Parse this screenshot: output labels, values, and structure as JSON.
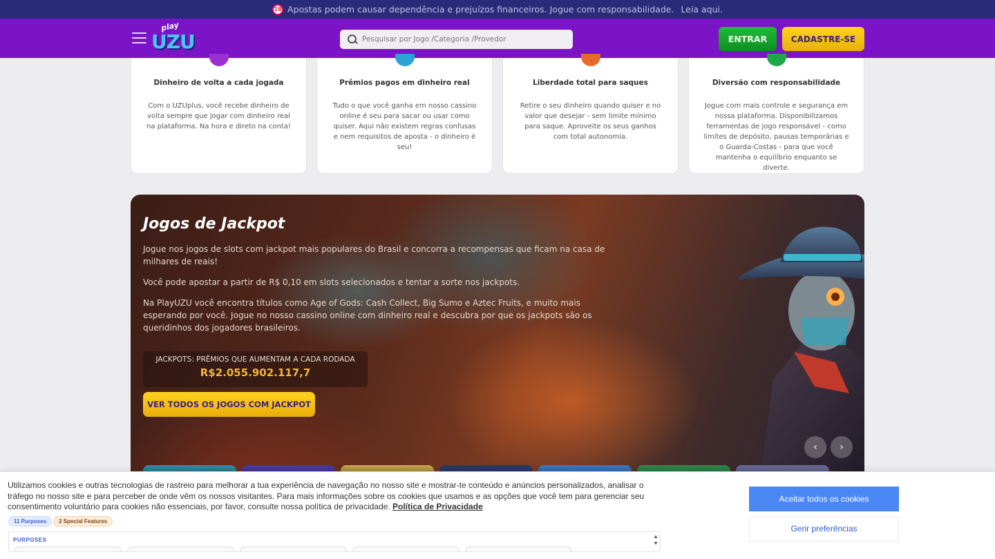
{
  "warning_bar": {
    "age_badge": "18",
    "text": "Apostas podem causar dependência e prejuízos financeiros. Jogue com responsabilidade.",
    "link": "Leia aqui."
  },
  "header": {
    "logo_play": "play",
    "logo_uzu": "UZU",
    "search_placeholder": "Pesquisar por Jogo /Categoria /Provedor",
    "login_label": "ENTRAR",
    "signup_label": "CADASTRE-SE"
  },
  "features": [
    {
      "title": "Dinheiro de volta a cada jogada",
      "text": "Com o UZUplus, você recebe dinheiro de volta sempre que jogar com dinheiro real na plataforma. Na hora e direto na conta!",
      "icon": "star-icon",
      "color": "#9b2fd0"
    },
    {
      "title": "Prêmios pagos em dinheiro real",
      "text": "Tudo o que você ganha em nosso cassino online é seu para sacar ou usar como quiser. Aqui não existem regras confusas e nem requisitos de aposta - o dinheiro é seu!",
      "icon": "gem-icon",
      "color": "#2aa3d6"
    },
    {
      "title": "Liberdade total para saques",
      "text": "Retire o seu dinheiro quando quiser e no valor que desejar - sem limite mínimo para saque. Aproveite os seus ganhos com total autonomia.",
      "icon": "rocket-icon",
      "color": "#e66a2c"
    },
    {
      "title": "Diversão com responsabilidade",
      "text": "Jogue com mais controle e segurança em nossa plataforma. Disponibilizamos ferramentas de jogo responsável - como limites de depósito, pausas temporárias e o Guarda-Costas - para que você mantenha o equilíbrio enquanto se diverte.",
      "icon": "shield-icon",
      "color": "#1fa84a"
    }
  ],
  "jackpot": {
    "title": "Jogos de Jackpot",
    "paragraph1": "Jogue nos jogos de slots com jackpot mais populares do Brasil e concorra a recompensas que ficam na casa de milhares de reais!",
    "paragraph2": "Você pode apostar a partir de R$ 0,10 em slots selecionados e tentar a sorte nos jackpots.",
    "paragraph3": "Na PlayUZU você encontra títulos como Age of Gods: Cash Collect, Big Sumo e Aztec Fruits, e muito mais esperando por você. Jogue no nosso cassino online com dinheiro real e descubra por que os jackpots são os queridinhos dos jogadores brasileiros.",
    "counter_label": "JACKPOTS: PRÊMIOS QUE AUMENTAM A CADA RODADA",
    "counter_value": "R$2.055.902.117,7",
    "cta_label": "VER TODOS OS JOGOS COM JACKPOT",
    "prev_icon": "‹",
    "next_icon": "›",
    "thumb_colors": [
      "#2f8fa8",
      "#4b3aa8",
      "#c9a84a",
      "#2a3a6a",
      "#3a7ac8",
      "#2e8a4a",
      "#6a6a9a"
    ]
  },
  "cookie": {
    "text": "Utilizamos cookies e outras tecnologias de rastreio para melhorar a tua experiência de navegação no nosso site e mostrar-te conteúdo e anúncios personalizados, analisar o tráfego no nosso site e para perceber de onde vêm os nossos visitantes. Para mais informações sobre os cookies que usamos e as opções que você tem para gerenciar seu consentimento voluntário para cookies não essenciais, por favor, consulte nossa política de privacidade.",
    "policy_link": "Política de Privacidade",
    "purposes_badge": "11 Purposes",
    "features_badge": "2 Special Features",
    "purposes_title": "PURPOSES",
    "accept_label": "Aceitar todos os cookies",
    "manage_label": "Gerir preferências"
  }
}
